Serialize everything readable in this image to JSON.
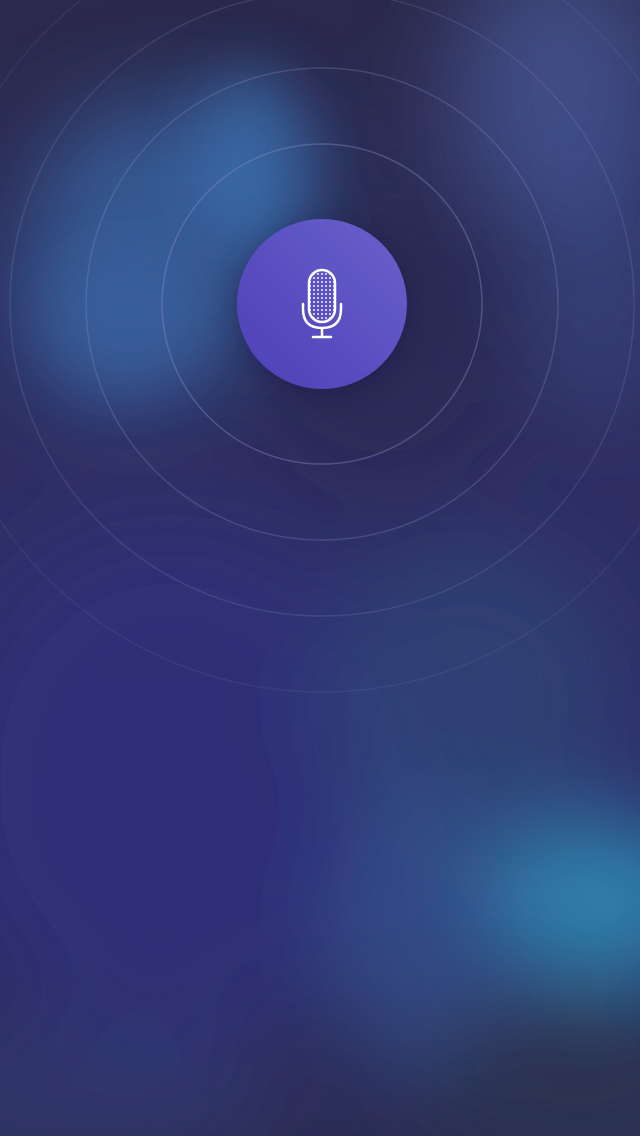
{
  "screen": {
    "name": "voice-input-screen"
  },
  "mic_button": {
    "icon": "microphone-icon",
    "state": "listening"
  },
  "colors": {
    "background_base": "#2d2b5e",
    "accent_purple": "#5a50c2",
    "accent_cyan": "#2e8fb8",
    "ring_stroke": "#8f8fc8",
    "icon_color": "#ffffff"
  }
}
